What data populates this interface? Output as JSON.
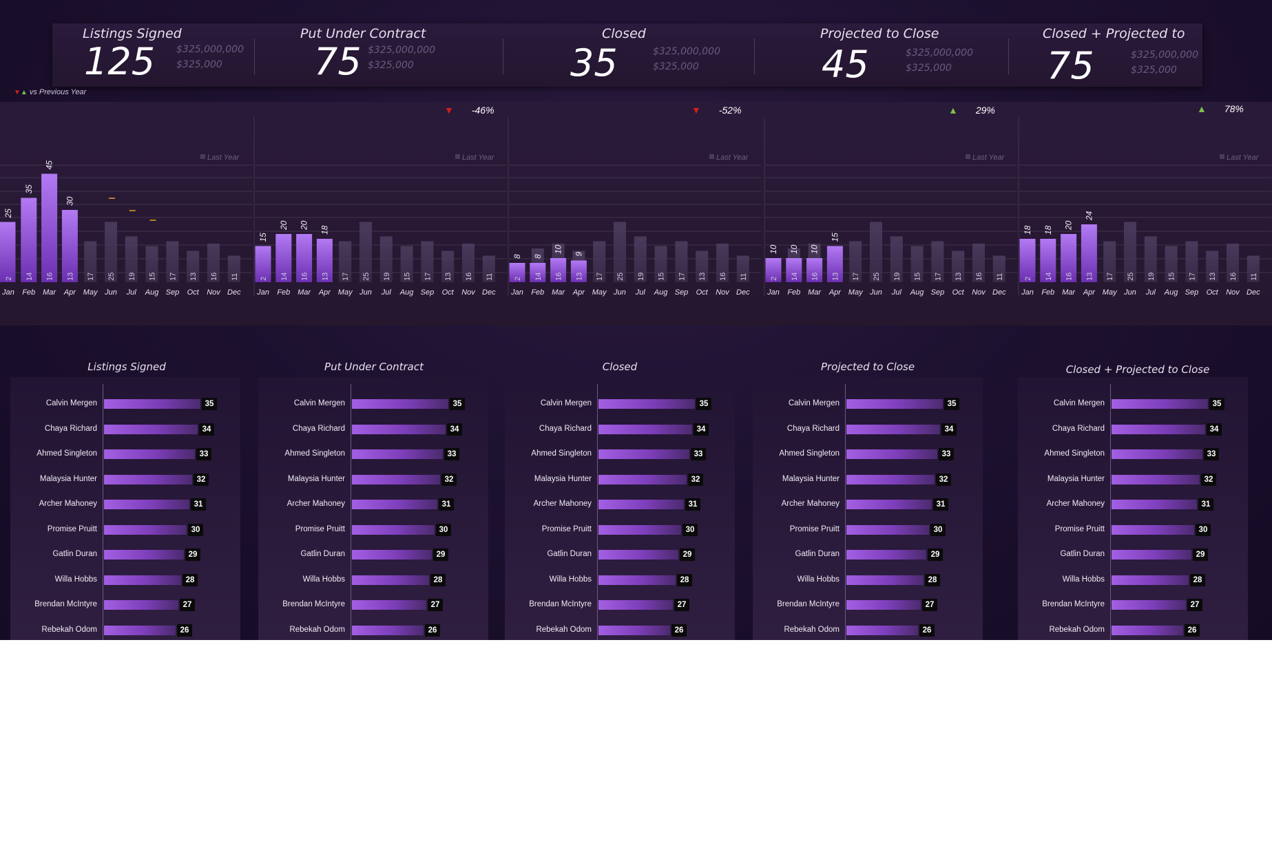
{
  "kpis": [
    {
      "title": "Listings Signed",
      "value": "125",
      "sub1": "$325,000,000",
      "sub2": "$325,000"
    },
    {
      "title": "Put Under Contract",
      "value": "75",
      "sub1": "$325,000,000",
      "sub2": "$325,000"
    },
    {
      "title": "Closed",
      "value": "35",
      "sub1": "$325,000,000",
      "sub2": "$325,000"
    },
    {
      "title": "Projected to Close",
      "value": "45",
      "sub1": "$325,000,000",
      "sub2": "$325,000"
    },
    {
      "title": "Closed + Projected to",
      "value": "75",
      "sub1": "$325,000,000",
      "sub2": "$325,000"
    }
  ],
  "legend_note": "vs Previous Year",
  "deltas": [
    {
      "direction": "down",
      "text": "-46%"
    },
    {
      "direction": "down",
      "text": "-52%"
    },
    {
      "direction": "up",
      "text": "29%"
    },
    {
      "direction": "up",
      "text": "78%"
    }
  ],
  "chart_data": [
    {
      "type": "bar",
      "legend_label": "Last Year",
      "categories": [
        "Jan",
        "Feb",
        "Mar",
        "Apr",
        "May",
        "Jun",
        "Jul",
        "Aug",
        "Sep",
        "Oct",
        "Nov",
        "Dec"
      ],
      "series": [
        {
          "name": "Last Year",
          "values": [
            2,
            14,
            16,
            13,
            17,
            25,
            19,
            15,
            17,
            13,
            16,
            11
          ]
        }
      ],
      "current": [
        25,
        35,
        45,
        30,
        null,
        null,
        null,
        null,
        null,
        null,
        null,
        null
      ],
      "markers": [
        {
          "month": "Jun"
        },
        {
          "month": "Jul"
        },
        {
          "month": "Aug"
        }
      ],
      "ylim": [
        0,
        50
      ]
    },
    {
      "type": "bar",
      "legend_label": "Last Year",
      "categories": [
        "Jan",
        "Feb",
        "Mar",
        "Apr",
        "May",
        "Jun",
        "Jul",
        "Aug",
        "Sep",
        "Oct",
        "Nov",
        "Dec"
      ],
      "series": [
        {
          "name": "Last Year",
          "values": [
            2,
            14,
            16,
            13,
            17,
            25,
            19,
            15,
            17,
            13,
            16,
            11
          ]
        }
      ],
      "current": [
        15,
        20,
        20,
        18,
        null,
        null,
        null,
        null,
        null,
        null,
        null,
        null
      ],
      "ylim": [
        0,
        50
      ]
    },
    {
      "type": "bar",
      "legend_label": "Last Year",
      "categories": [
        "Jan",
        "Feb",
        "Mar",
        "Apr",
        "May",
        "Jun",
        "Jul",
        "Aug",
        "Sep",
        "Oct",
        "Nov",
        "Dec"
      ],
      "series": [
        {
          "name": "Last Year",
          "values": [
            2,
            14,
            16,
            13,
            17,
            25,
            19,
            15,
            17,
            13,
            16,
            11
          ]
        }
      ],
      "current": [
        8,
        8,
        10,
        9,
        null,
        null,
        null,
        null,
        null,
        null,
        null,
        null
      ],
      "ylim": [
        0,
        50
      ]
    },
    {
      "type": "bar",
      "legend_label": "Last Year",
      "categories": [
        "Jan",
        "Feb",
        "Mar",
        "Apr",
        "May",
        "Jun",
        "Jul",
        "Aug",
        "Sep",
        "Oct",
        "Nov",
        "Dec"
      ],
      "series": [
        {
          "name": "Last Year",
          "values": [
            2,
            14,
            16,
            13,
            17,
            25,
            19,
            15,
            17,
            13,
            16,
            11
          ]
        }
      ],
      "current": [
        10,
        10,
        10,
        15,
        null,
        null,
        null,
        null,
        null,
        null,
        null,
        null
      ],
      "ylim": [
        0,
        50
      ]
    },
    {
      "type": "bar",
      "legend_label": "Last Year",
      "categories": [
        "Jan",
        "Feb",
        "Mar",
        "Apr",
        "May",
        "Jun",
        "Jul",
        "Aug",
        "Sep",
        "Oct",
        "Nov",
        "Dec"
      ],
      "series": [
        {
          "name": "Last Year",
          "values": [
            2,
            14,
            16,
            13,
            17,
            25,
            19,
            15,
            17,
            13,
            16,
            11
          ]
        }
      ],
      "current": [
        18,
        18,
        20,
        24,
        null,
        null,
        null,
        null,
        null,
        null,
        null,
        null
      ],
      "ylim": [
        0,
        50
      ]
    }
  ],
  "rank_panels": [
    {
      "title": "Listings Signed"
    },
    {
      "title": "Put Under Contract"
    },
    {
      "title": "Closed"
    },
    {
      "title": "Projected to Close"
    },
    {
      "title": "Closed + Projected to Close"
    }
  ],
  "agents": [
    {
      "name": "Calvin Mergen",
      "value": 35
    },
    {
      "name": "Chaya Richard",
      "value": 34
    },
    {
      "name": "Ahmed Singleton",
      "value": 33
    },
    {
      "name": "Malaysia Hunter",
      "value": 32
    },
    {
      "name": "Archer Mahoney",
      "value": 31
    },
    {
      "name": "Promise Pruitt",
      "value": 30
    },
    {
      "name": "Gatlin Duran",
      "value": 29
    },
    {
      "name": "Willa Hobbs",
      "value": 28
    },
    {
      "name": "Brendan McIntyre",
      "value": 27
    },
    {
      "name": "Rebekah Odom",
      "value": 26
    }
  ],
  "colors": {
    "bar_current": "#a866ee",
    "bar_last_year": "#4a3a5c",
    "positive": "#7cc24a",
    "negative": "#d41e1e",
    "marker": "#e0a51c"
  }
}
